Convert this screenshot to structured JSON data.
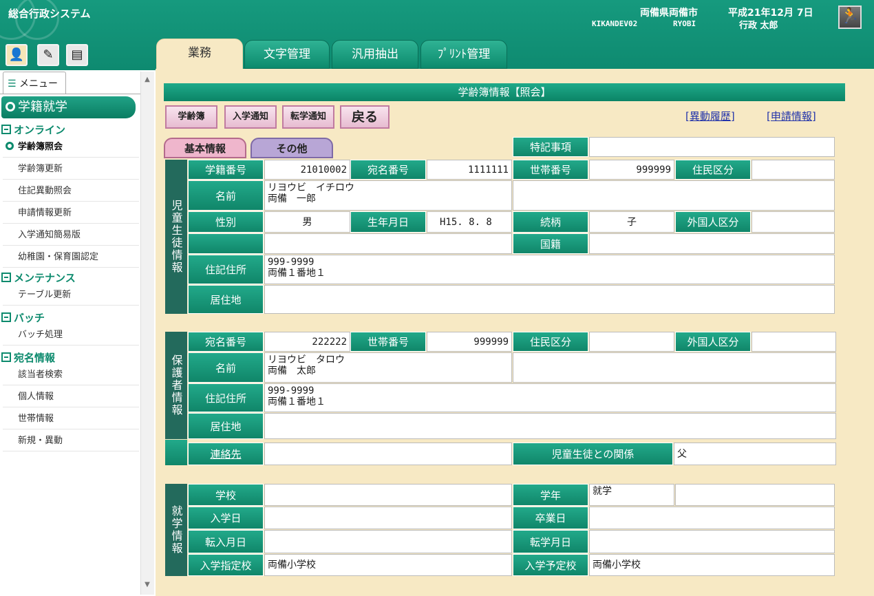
{
  "header": {
    "app_title": "総合行政システム",
    "org": "両備県両備市",
    "date": "平成21年12月 7日",
    "terminal": "KIKANDEV02",
    "user_id": "RYOBI",
    "user_name": "行政 太郎",
    "exit_icon": "running-man-icon"
  },
  "tabs": [
    {
      "label": "業務",
      "active": true
    },
    {
      "label": "文字管理",
      "active": false
    },
    {
      "label": "汎用抽出",
      "active": false
    },
    {
      "label": "ﾌﾟﾘﾝﾄ管理",
      "active": false
    }
  ],
  "menu": {
    "tab_label": "メニュー",
    "header": "学籍就学",
    "categories": [
      {
        "label": "オンライン",
        "items": [
          "学齢簿照会",
          "学齢簿更新",
          "住記異動照会",
          "申請情報更新",
          "入学通知簡易版",
          "幼稚園・保育園認定"
        ]
      },
      {
        "label": "メンテナンス",
        "items": [
          "テーブル更新"
        ]
      },
      {
        "label": "バッチ",
        "items": [
          "バッチ処理"
        ]
      },
      {
        "label": "宛名情報",
        "items": [
          "該当者検索",
          "個人情報",
          "世帯情報",
          "新規・異動"
        ]
      }
    ]
  },
  "form": {
    "title": "学齢簿情報【照会】",
    "buttons": [
      "学齢簿",
      "入学通知",
      "転学通知",
      "戻る"
    ],
    "links": [
      "[異動履歴]",
      "[申請情報]"
    ],
    "subtabs": [
      "基本情報",
      "その他"
    ]
  },
  "child": {
    "section": "児童生徒情報",
    "tokki_label": "特記事項",
    "tokki_value": "",
    "gakuseki_label": "学籍番号",
    "gakuseki_value": "21010002",
    "atena_label": "宛名番号",
    "atena_value": "1111111",
    "setai_label": "世帯番号",
    "setai_value": "999999",
    "jumin_label": "住民区分",
    "jumin_value": "",
    "name_label": "名前",
    "name_value": "リヨウビ　イチロウ\n両備　一郎",
    "sex_label": "性別",
    "sex_value": "男",
    "birth_label": "生年月日",
    "birth_value": "H15. 8. 8",
    "zokugara_label": "続柄",
    "zokugara_value": "子",
    "gaikoku_label": "外国人区分",
    "gaikoku_value": "",
    "kokuseki_label": "国籍",
    "kokuseki_value": "",
    "address_label": "住記住所",
    "address_value": "999-9999\n両備１番地１",
    "kyojuchi_label": "居住地",
    "kyojuchi_value": ""
  },
  "guardian": {
    "section": "保護者情報",
    "atena_label": "宛名番号",
    "atena_value": "222222",
    "setai_label": "世帯番号",
    "setai_value": "999999",
    "jumin_label": "住民区分",
    "jumin_value": "",
    "gaikoku_label": "外国人区分",
    "gaikoku_value": "",
    "name_label": "名前",
    "name_value": "リヨウビ　タロウ\n両備　太郎",
    "address_label": "住記住所",
    "address_value": "999-9999\n両備１番地１",
    "kyojuchi_label": "居住地",
    "kyojuchi_value": "",
    "contact_label": "連絡先",
    "contact_value": "",
    "relation_label": "児童生徒との関係",
    "relation_value": "父"
  },
  "school": {
    "section": "就学情報",
    "school_label": "学校",
    "school_value": "",
    "grade_label": "学年",
    "grade_value": "就学",
    "grade_extra": "",
    "enroll_label": "入学日",
    "enroll_value": "",
    "grad_label": "卒業日",
    "grad_value": "",
    "transfer_in_label": "転入月日",
    "transfer_in_value": "",
    "transfer_label": "転学月日",
    "transfer_value": "",
    "designated_label": "入学指定校",
    "designated_value": "両備小学校",
    "planned_label": "入学予定校",
    "planned_value": "両備小学校"
  }
}
